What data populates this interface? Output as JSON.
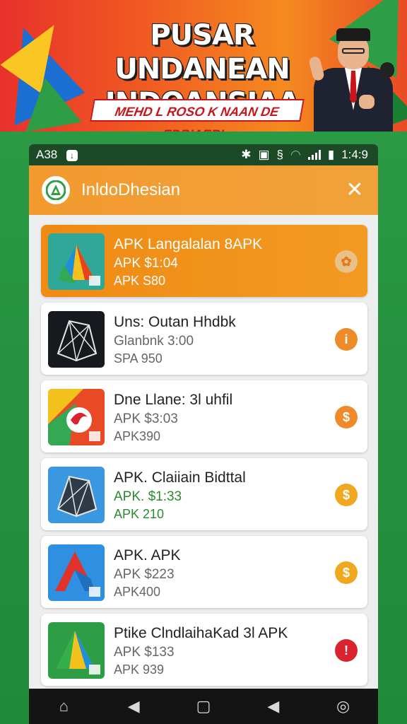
{
  "banner": {
    "title_line1": "PUSAR UNDANEAN",
    "title_line2": "INDOANSIAA",
    "subtitle": "MEHD L ROSO K NAAN DE EDBIAERI"
  },
  "statusbar": {
    "left_text": "A38",
    "time": "1:4:9"
  },
  "appbar": {
    "title": "InldoDhesian",
    "logo_letter": "A",
    "close_icon": "✕"
  },
  "items": [
    {
      "title": "APK Langalalan 8APK",
      "line2": "APK $1:04",
      "line3": "APK S80",
      "badge": "✿",
      "badge_color": "#e9c08a",
      "icon": "play-triangle-icon",
      "active": true
    },
    {
      "title": "Uns: Outan Hhdbk",
      "line2": "Glanbnk 3:00",
      "line3": "SPA 950",
      "badge": "i",
      "badge_color": "#ef8a28",
      "icon": "diamond-wire-icon"
    },
    {
      "title": "Dne Llane: 3l uhfil",
      "line2": "APK $3:03",
      "line3": "APK390",
      "badge": "$",
      "badge_color": "#ef8a28",
      "icon": "swirl-icon"
    },
    {
      "title": "APK. Claiiain Bidttal",
      "line2": "APK. $1:33",
      "line3": "APK 210",
      "badge": "$",
      "badge_color": "#f0a81e",
      "icon": "diamond-blue-icon",
      "green": true
    },
    {
      "title": "APK. APK",
      "line2": "APK $223",
      "line3": "APK400",
      "badge": "$",
      "badge_color": "#f0a81e",
      "icon": "red-a-icon"
    },
    {
      "title": "Ptike ClndlaihaKad 3l APK",
      "line2": "APK $133",
      "line3": "APK 939",
      "badge": "!",
      "badge_color": "#d9232e",
      "icon": "green-triangle-icon"
    }
  ],
  "navbar": {
    "home": "⌂",
    "back": "◀",
    "recents": "▢",
    "back2": "◀",
    "camera": "◎"
  },
  "colors": {
    "accent": "#f29a2e",
    "background": "#2e9e46"
  }
}
